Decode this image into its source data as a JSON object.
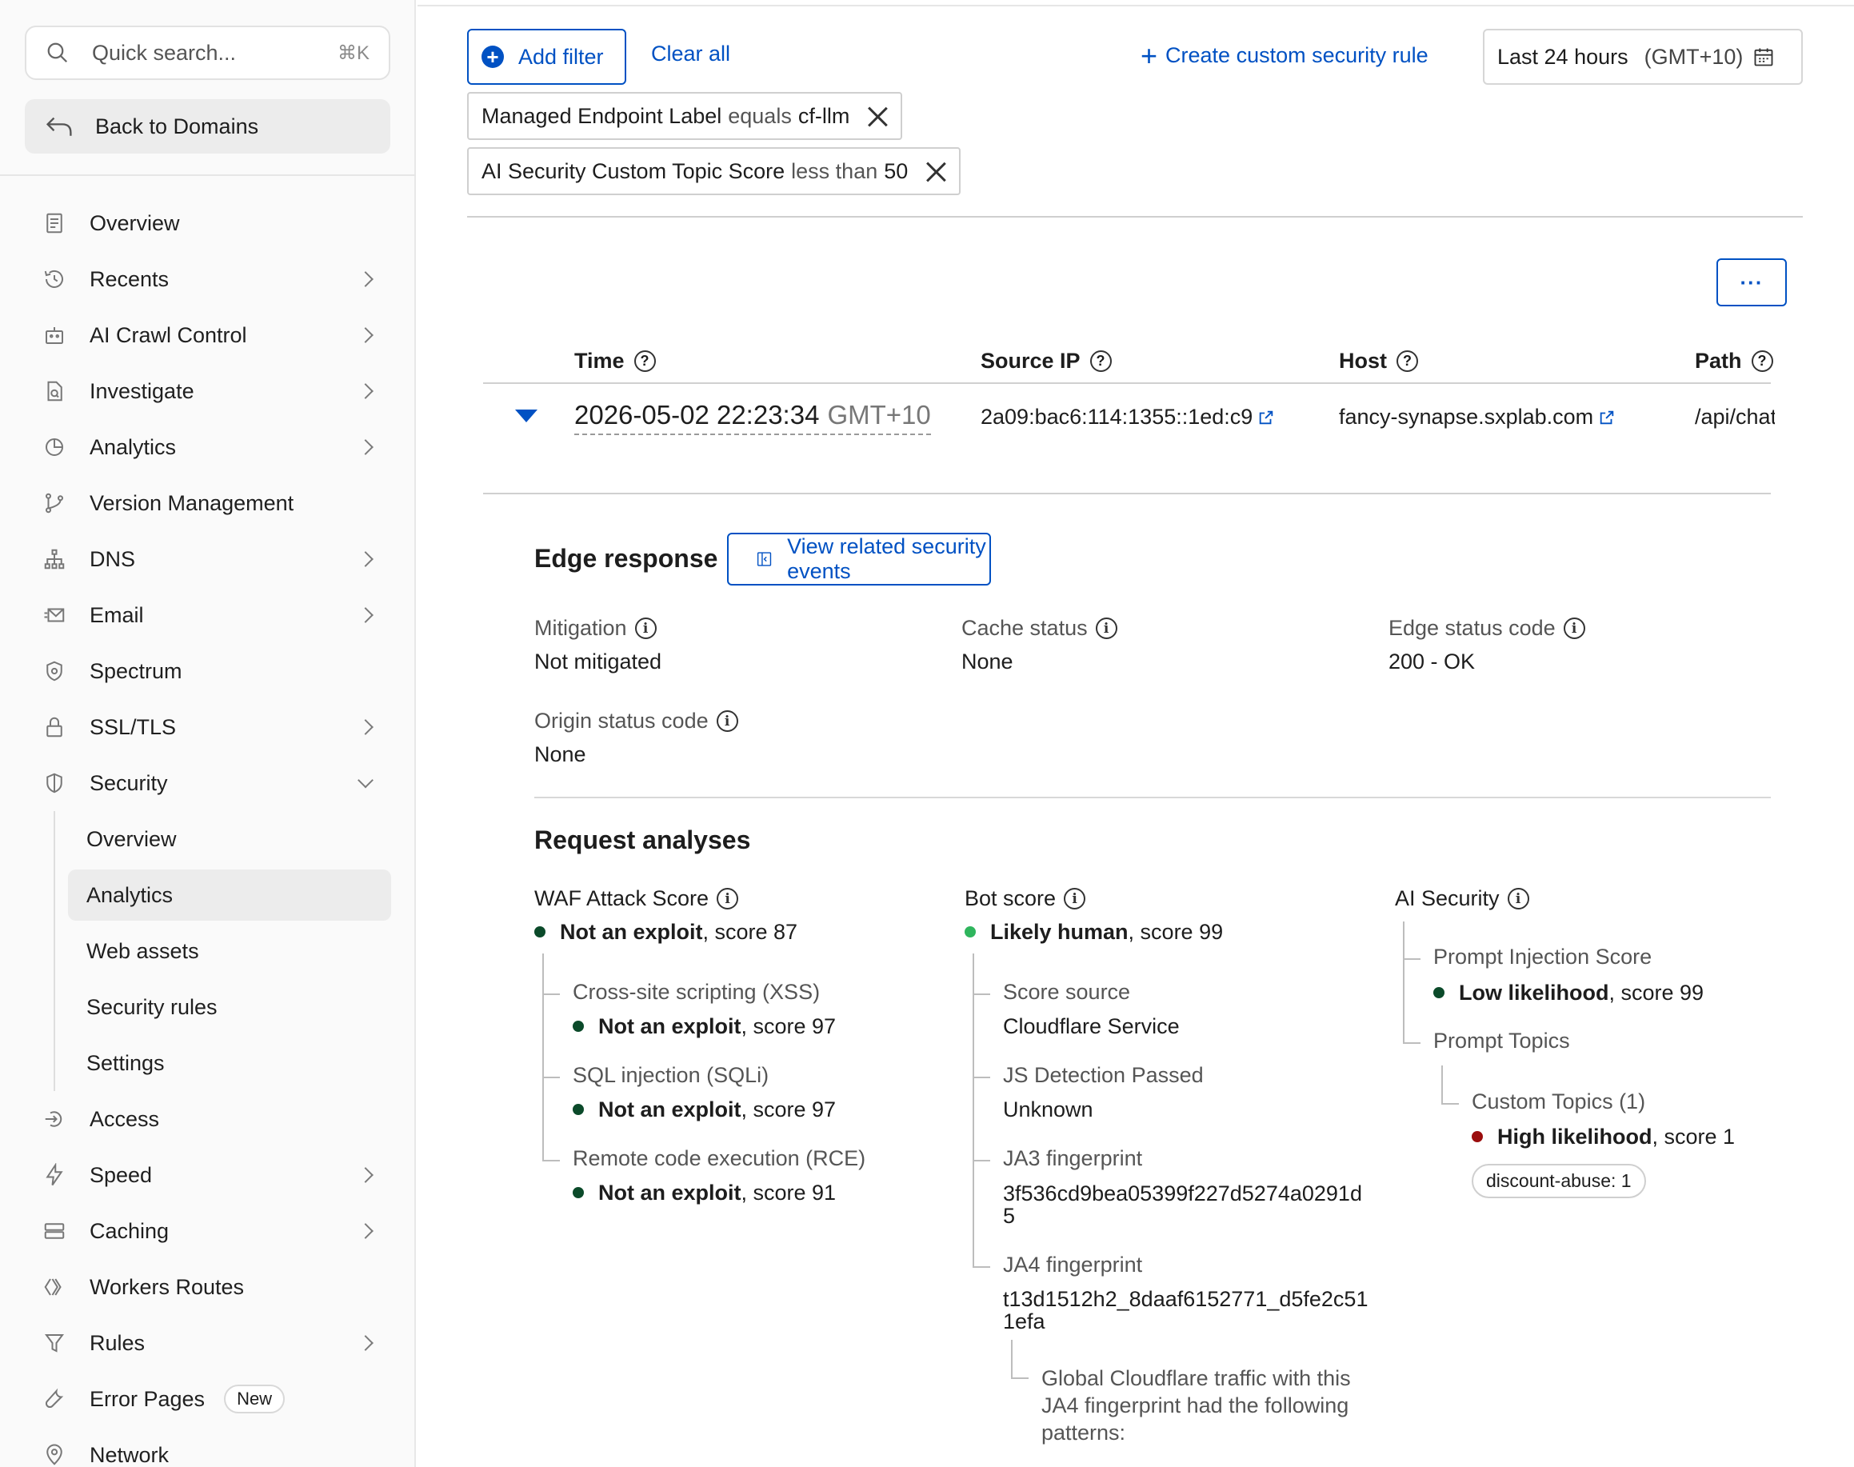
{
  "sidebar": {
    "search_placeholder": "Quick search...",
    "search_shortcut": "⌘K",
    "back_label": "Back to Domains",
    "items": [
      {
        "label": "Overview"
      },
      {
        "label": "Recents"
      },
      {
        "label": "AI Crawl Control"
      },
      {
        "label": "Investigate"
      },
      {
        "label": "Analytics"
      },
      {
        "label": "Version Management"
      },
      {
        "label": "DNS"
      },
      {
        "label": "Email"
      },
      {
        "label": "Spectrum"
      },
      {
        "label": "SSL/TLS"
      },
      {
        "label": "Security"
      }
    ],
    "security_sub": [
      {
        "label": "Overview"
      },
      {
        "label": "Analytics"
      },
      {
        "label": "Web assets"
      },
      {
        "label": "Security rules"
      },
      {
        "label": "Settings"
      }
    ],
    "items_after": [
      {
        "label": "Access"
      },
      {
        "label": "Speed"
      },
      {
        "label": "Caching"
      },
      {
        "label": "Workers Routes"
      },
      {
        "label": "Rules"
      },
      {
        "label": "Error Pages",
        "badge": "New"
      },
      {
        "label": "Network"
      }
    ]
  },
  "toolbar": {
    "add_filter": "Add filter",
    "clear_all": "Clear all",
    "create_rule": "Create custom security rule",
    "date_range": "Last 24 hours",
    "timezone": "(GMT+10)",
    "more": "···"
  },
  "filters": [
    {
      "field": "Managed Endpoint Label",
      "op": "equals",
      "value": "cf-llm"
    },
    {
      "field": "AI Security Custom Topic Score",
      "op": "less than",
      "value": "50"
    }
  ],
  "table": {
    "headers": [
      "Time",
      "Source IP",
      "Host",
      "Path"
    ],
    "row": {
      "time": "2026-05-02 22:23:34",
      "tz": "GMT+10",
      "source_ip": "2a09:bac6:114:1355::1ed:c9",
      "host": "fancy-synapse.sxplab.com",
      "path": "/api/chat"
    }
  },
  "edge": {
    "title": "Edge response",
    "related_button": "View related security events",
    "mitigation_label": "Mitigation",
    "mitigation_value": "Not mitigated",
    "cache_label": "Cache status",
    "cache_value": "None",
    "edge_code_label": "Edge status code",
    "edge_code_value": "200 - OK",
    "origin_label": "Origin status code",
    "origin_value": "None"
  },
  "analyses": {
    "title": "Request analyses",
    "waf": {
      "label": "WAF Attack Score",
      "verdict": "Not an exploit",
      "score": ", score 87",
      "xss_label": "Cross-site scripting (XSS)",
      "xss_verdict": "Not an exploit",
      "xss_score": ", score 97",
      "sqli_label": "SQL injection (SQLi)",
      "sqli_verdict": "Not an exploit",
      "sqli_score": ", score 97",
      "rce_label": "Remote code execution (RCE)",
      "rce_verdict": "Not an exploit",
      "rce_score": ", score 91"
    },
    "bot": {
      "label": "Bot score",
      "verdict": "Likely human",
      "score": ", score 99",
      "source_label": "Score source",
      "source_value": "Cloudflare Service",
      "js_label": "JS Detection Passed",
      "js_value": "Unknown",
      "ja3_label": "JA3 fingerprint",
      "ja3_value": "3f536cd9bea05399f227d5274a0291d5",
      "ja4_label": "JA4 fingerprint",
      "ja4_value": "t13d1512h2_8daaf6152771_d5fe2c511efa",
      "global_text": "Global Cloudflare traffic with this JA4 fingerprint had the following patterns:"
    },
    "ai": {
      "label": "AI Security",
      "pi_label": "Prompt Injection Score",
      "pi_verdict": "Low likelihood",
      "pi_score": ", score 99",
      "topics_label": "Prompt Topics",
      "custom_label": "Custom Topics (1)",
      "custom_verdict": "High likelihood",
      "custom_score": ", score 1",
      "pill": "discount-abuse: 1"
    }
  },
  "colors": {
    "accent": "#0051c3",
    "good_dark": "#0b4a2a",
    "good_light": "#2fb55d",
    "bad": "#9b0d0d"
  }
}
